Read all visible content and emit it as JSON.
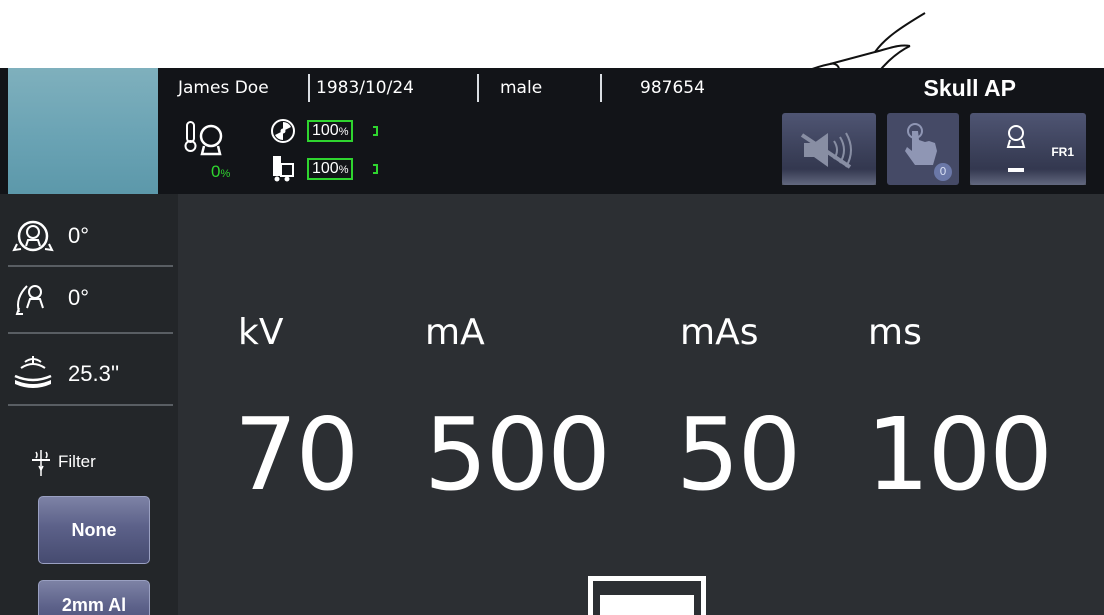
{
  "patient": {
    "name": "James Doe",
    "dob": "1983/10/24",
    "sex": "male",
    "id": "987654"
  },
  "procedure": "Skull AP",
  "status": {
    "tube_heat_percent": "0",
    "percent_symbol": "%",
    "radiation_battery": "100",
    "generator_battery": "100"
  },
  "toolbar": {
    "fr_label": "FR1",
    "touch_badge": "0"
  },
  "sidebar": {
    "rotation_angle": "0°",
    "tilt_angle": "0°",
    "sid_distance": "25.3''",
    "filter_label": "Filter",
    "filter_options": [
      "None",
      "2mm Al"
    ]
  },
  "params": {
    "labels": [
      "kV",
      "mA",
      "mAs",
      "ms"
    ],
    "values": [
      "70",
      "500",
      "50",
      "100"
    ]
  },
  "colors": {
    "topbar": "#121418",
    "main_bg": "#2c2f33",
    "sidebar_bg": "#232629",
    "status_green": "#2fd52f",
    "button_blue": "#464b70"
  }
}
